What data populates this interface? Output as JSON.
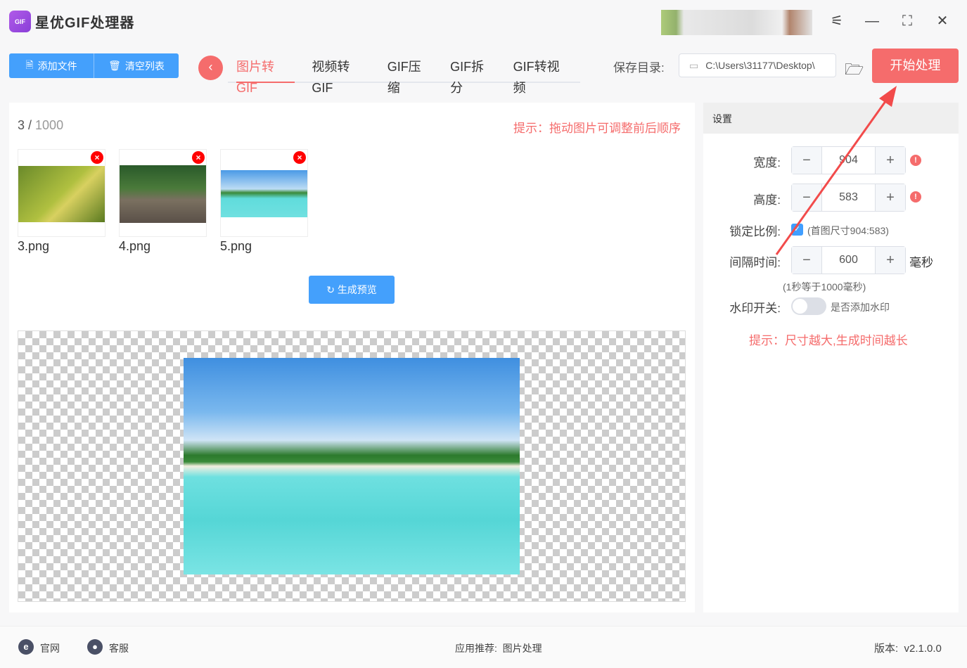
{
  "app": {
    "title": "星优GIF处理器",
    "logo_text": "GIF"
  },
  "toolbar": {
    "add_file": "添加文件",
    "clear_list": "清空列表",
    "save_label": "保存目录:",
    "save_path": "C:\\Users\\31177\\Desktop\\",
    "start": "开始处理"
  },
  "tabs": [
    {
      "label": "图片转GIF"
    },
    {
      "label": "视频转GIF"
    },
    {
      "label": "GIF压缩"
    },
    {
      "label": "GIF拆分"
    },
    {
      "label": "GIF转视频"
    }
  ],
  "list": {
    "count": "3",
    "max": "1000",
    "hint": "提示：拖动图片可调整前后顺序",
    "files": [
      {
        "name": "3.png"
      },
      {
        "name": "4.png"
      },
      {
        "name": "5.png"
      }
    ],
    "preview_button": "生成预览"
  },
  "settings": {
    "title": "设置",
    "width_label": "宽度:",
    "width": "904",
    "height_label": "高度:",
    "height": "583",
    "lock_label": "锁定比例:",
    "lock_checked": true,
    "lock_note": "(首图尺寸904:583)",
    "interval_label": "间隔时间:",
    "interval": "600",
    "interval_unit": "毫秒",
    "interval_note": "(1秒等于1000毫秒)",
    "watermark_label": "水印开关:",
    "watermark_on": false,
    "watermark_note": "是否添加水印",
    "hint": "提示：尺寸越大,生成时间越长"
  },
  "footer": {
    "website": "官网",
    "support": "客服",
    "recommend": "应用推荐:  图片处理",
    "version": "版本:  v2.1.0.0"
  },
  "colors": {
    "accent": "#f56c6c",
    "primary": "#44a0fc"
  }
}
